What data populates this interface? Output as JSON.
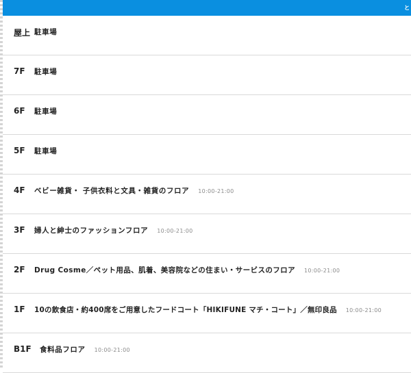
{
  "topbar": {
    "text": "と"
  },
  "floors": [
    {
      "label": "屋上",
      "desc": "駐車場",
      "hours": ""
    },
    {
      "label": "7F",
      "desc": "駐車場",
      "hours": ""
    },
    {
      "label": "6F",
      "desc": "駐車場",
      "hours": ""
    },
    {
      "label": "5F",
      "desc": "駐車場",
      "hours": ""
    },
    {
      "label": "4F",
      "desc": "ベビー雑貨・ 子供衣料と文具・雑貨のフロア",
      "hours": "10:00-21:00"
    },
    {
      "label": "3F",
      "desc": "婦人と紳士のファッションフロア",
      "hours": "10:00-21:00"
    },
    {
      "label": "2F",
      "desc": "Drug Cosme／ペット用品、肌着、美容院などの住まい・サービスのフロア",
      "hours": "10:00-21:00"
    },
    {
      "label": "1F",
      "desc": "10の飲食店・約400席をご用意したフードコート「HIKIFUNE マチ・コート」／無印良品",
      "hours": "10:00-21:00"
    },
    {
      "label": "B1F",
      "desc": "食料品フロア",
      "hours": "10:00-21:00"
    }
  ]
}
